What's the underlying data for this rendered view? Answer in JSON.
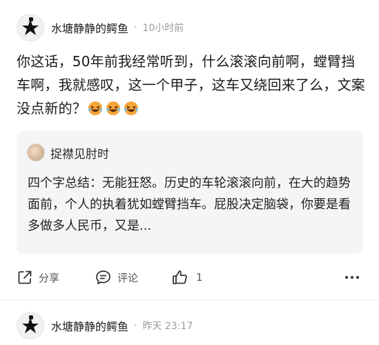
{
  "posts": [
    {
      "author": "水塘静静的鳄鱼",
      "time": "10小时前",
      "content": "你这话，50年前我经常听到，什么滚滚向前啊，螳臂挡车啊，我就感叹，这一个甲子，这车又绕回来了么，文案没点新的？",
      "emojis": [
        "laughing-tears-emoji",
        "laughing-tears-emoji",
        "laughing-tears-emoji"
      ],
      "quote": {
        "author": "捉襟见肘时",
        "text": "四个字总结：无能狂怒。历史的车轮滚滚向前，在大的趋势面前，个人的执着犹如螳臂挡车。屁股决定脑袋，你要是看多做多人民币，又是..."
      },
      "actions": {
        "share": "分享",
        "comment": "评论",
        "like_count": "1"
      }
    },
    {
      "author": "水塘静静的鳄鱼",
      "time": "昨天 23:17"
    }
  ],
  "separator": "·",
  "colors": {
    "quote_bg": "#f5f5f7",
    "emoji_face": "#f7a43a"
  }
}
